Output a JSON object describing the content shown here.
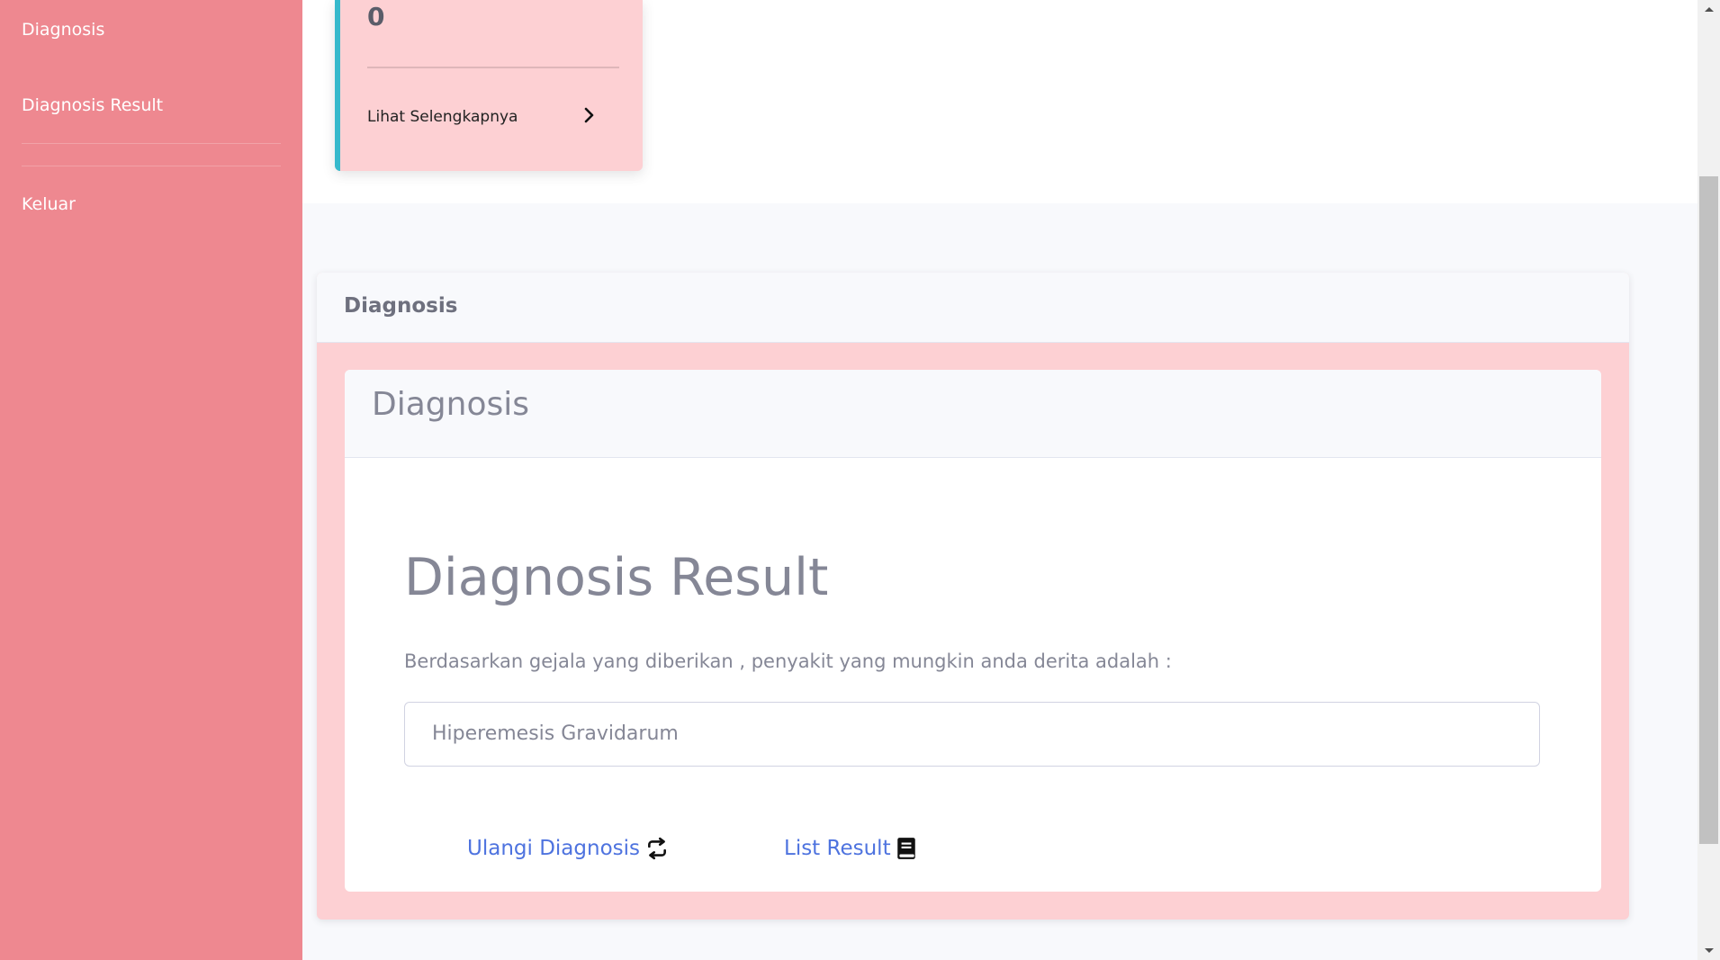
{
  "sidebar": {
    "items": [
      {
        "label": "Diagnosis"
      },
      {
        "label": "Diagnosis Result"
      },
      {
        "label": "Keluar"
      }
    ]
  },
  "stat_card": {
    "value": "0",
    "link_label": "Lihat Selengkapnya"
  },
  "outer_card": {
    "title": "Diagnosis"
  },
  "inner_card": {
    "title": "Diagnosis",
    "result_title": "Diagnosis Result",
    "description": "Berdasarkan gejala yang diberikan , penyakit yang mungkin anda derita adalah :",
    "result_value": "Hiperemesis Gravidarum",
    "actions": [
      {
        "label": "Ulangi Diagnosis",
        "icon": "repeat-icon"
      },
      {
        "label": "List Result",
        "icon": "book-icon"
      }
    ]
  },
  "colors": {
    "sidebar": "#ee8890",
    "card_pink": "#fdd0d3",
    "accent_cyan": "#36b9cc",
    "link_blue": "#4e73df",
    "text_gray": "#858796"
  }
}
